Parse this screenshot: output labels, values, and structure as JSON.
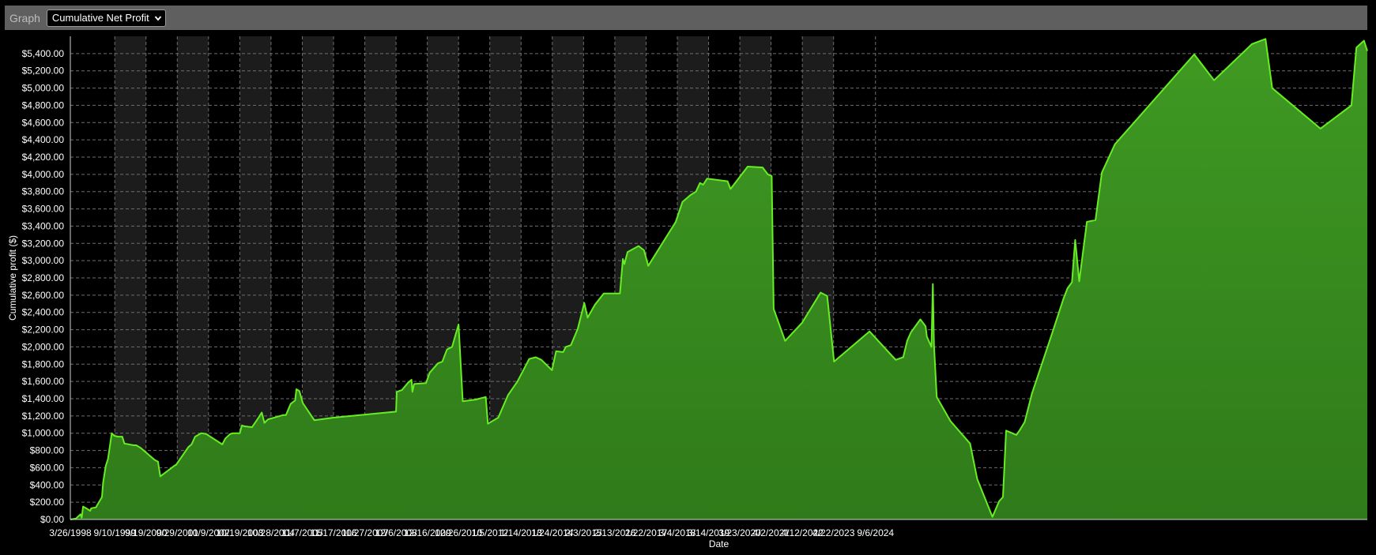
{
  "toolbar": {
    "label": "Graph",
    "selected_graph": "Cumulative Net Profit",
    "dropdown_icon": "chevron-down-icon"
  },
  "colors": {
    "background": "#000000",
    "band": "#1c1c1c",
    "grid": "#6e6e6e",
    "line": "#66ee22",
    "fill": "#3f9a22",
    "fill_bottom": "#2f7a1a",
    "text": "#ffffff"
  },
  "chart_data": {
    "type": "area",
    "xlabel": "Date",
    "ylabel": "Cumulative profit ($)",
    "ylim": [
      0,
      5600
    ],
    "yticks": [
      0,
      200,
      400,
      600,
      800,
      1000,
      1200,
      1400,
      1600,
      1800,
      2000,
      2200,
      2400,
      2600,
      2800,
      3000,
      3200,
      3400,
      3600,
      3800,
      4000,
      4200,
      4400,
      4600,
      4800,
      5000,
      5200,
      5400
    ],
    "ytick_labels": [
      "$0.00",
      "$200.00",
      "$400.00",
      "$600.00",
      "$800.00",
      "$1,000.00",
      "$1,200.00",
      "$1,400.00",
      "$1,600.00",
      "$1,800.00",
      "$2,000.00",
      "$2,200.00",
      "$2,400.00",
      "$2,600.00",
      "$2,800.00",
      "$3,000.00",
      "$3,200.00",
      "$3,400.00",
      "$3,600.00",
      "$3,800.00",
      "$4,000.00",
      "$4,200.00",
      "$4,400.00",
      "$4,600.00",
      "$4,800.00",
      "$5,000.00",
      "$5,200.00",
      "$5,400.00"
    ],
    "xticks": [
      "3/26/1998",
      "9/10/1999",
      "9/19/2000",
      "9/29/2001",
      "10/9/2002",
      "10/19/2003",
      "10/28/2004",
      "11/7/2005",
      "11/17/2006",
      "11/27/2007",
      "12/6/2008",
      "12/16/2009",
      "12/26/2010",
      "1/5/2012",
      "1/14/2013",
      "1/24/2014",
      "2/3/2015",
      "2/13/2016",
      "2/22/2017",
      "3/4/2018",
      "3/14/2019",
      "3/23/2020",
      "4/2/2021",
      "4/12/2022",
      "4/22/2023",
      "9/6/2024"
    ],
    "grid": true,
    "legend": "none",
    "series": [
      {
        "points": [
          [
            "3/26/1998",
            0
          ],
          [
            "6/1/1998",
            10
          ],
          [
            "7/26/1998",
            60
          ],
          [
            "8/10/1998",
            20
          ],
          [
            "8/26/1998",
            150
          ],
          [
            "10/20/1998",
            120
          ],
          [
            "11/19/1998",
            100
          ],
          [
            "12/1/1998",
            130
          ],
          [
            "1/26/1999",
            140
          ],
          [
            "4/9/1999",
            260
          ],
          [
            "4/24/1999",
            430
          ],
          [
            "5/25/1999",
            620
          ],
          [
            "6/20/1999",
            700
          ],
          [
            "8/5/1999",
            1000
          ],
          [
            "9/4/1999",
            970
          ],
          [
            "10/20/1999",
            960
          ],
          [
            "12/9/1999",
            960
          ],
          [
            "1/4/2000",
            880
          ],
          [
            "4/25/2000",
            860
          ],
          [
            "5/25/2000",
            860
          ],
          [
            "7/16/2000",
            830
          ],
          [
            "1/2/2001",
            690
          ],
          [
            "2/10/2001",
            670
          ],
          [
            "3/9/2001",
            500
          ],
          [
            "9/5/2001",
            630
          ],
          [
            "9/13/2001",
            630
          ],
          [
            "12/15/2001",
            760
          ],
          [
            "2/10/2002",
            840
          ],
          [
            "3/20/2002",
            870
          ],
          [
            "4/30/2002",
            960
          ],
          [
            "7/14/2002",
            1000
          ],
          [
            "9/13/2002",
            990
          ],
          [
            "3/23/2003",
            870
          ],
          [
            "4/30/2003",
            940
          ],
          [
            "6/25/2003",
            990
          ],
          [
            "7/31/2003",
            1000
          ],
          [
            "8/15/2003",
            1000
          ],
          [
            "10/19/2003",
            1000
          ],
          [
            "11/13/2003",
            1090
          ],
          [
            "12/19/2003",
            1080
          ],
          [
            "3/14/2004",
            1070
          ],
          [
            "6/7/2004",
            1190
          ],
          [
            "7/9/2004",
            1240
          ],
          [
            "8/10/2004",
            1120
          ],
          [
            "9/22/2004",
            1160
          ],
          [
            "3/20/2005",
            1210
          ],
          [
            "4/25/2005",
            1210
          ],
          [
            "6/20/2005",
            1340
          ],
          [
            "8/13/2005",
            1380
          ],
          [
            "8/28/2005",
            1510
          ],
          [
            "10/3/2005",
            1490
          ],
          [
            "11/13/2005",
            1350
          ],
          [
            "4/1/2006",
            1150
          ],
          [
            "11/17/2006",
            1180
          ],
          [
            "12/6/2008",
            1250
          ],
          [
            "12/15/2008",
            1480
          ],
          [
            "2/14/2009",
            1500
          ],
          [
            "4/24/2009",
            1580
          ],
          [
            "6/10/2009",
            1620
          ],
          [
            "6/20/2009",
            1480
          ],
          [
            "7/10/2009",
            1570
          ],
          [
            "11/30/2009",
            1580
          ],
          [
            "1/13/2010",
            1700
          ],
          [
            "4/23/2010",
            1810
          ],
          [
            "6/15/2010",
            1830
          ],
          [
            "8/9/2010",
            1970
          ],
          [
            "10/9/2010",
            2000
          ],
          [
            "12/26/2010",
            2260
          ],
          [
            "2/14/2011",
            1370
          ],
          [
            "7/20/2011",
            1390
          ],
          [
            "11/17/2011",
            1420
          ],
          [
            "12/13/2011",
            1110
          ],
          [
            "4/15/2012",
            1180
          ],
          [
            "8/10/2012",
            1440
          ],
          [
            "12/3/2012",
            1600
          ],
          [
            "4/21/2013",
            1860
          ],
          [
            "7/10/2013",
            1880
          ],
          [
            "9/15/2013",
            1850
          ],
          [
            "1/20/2014",
            1730
          ],
          [
            "3/10/2014",
            1950
          ],
          [
            "6/4/2014",
            1940
          ],
          [
            "7/4/2014",
            2000
          ],
          [
            "9/4/2014",
            2020
          ],
          [
            "11/25/2014",
            2210
          ],
          [
            "2/12/2015",
            2510
          ],
          [
            "3/24/2015",
            2340
          ],
          [
            "6/20/2015",
            2490
          ],
          [
            "10/3/2015",
            2620
          ],
          [
            "1/20/2016",
            2620
          ],
          [
            "4/15/2016",
            2620
          ],
          [
            "5/20/2016",
            3020
          ],
          [
            "6/7/2016",
            2960
          ],
          [
            "7/15/2016",
            3100
          ],
          [
            "11/24/2016",
            3170
          ],
          [
            "1/28/2017",
            3120
          ],
          [
            "3/20/2017",
            2940
          ],
          [
            "2/13/2018",
            3450
          ],
          [
            "5/5/2018",
            3680
          ],
          [
            "8/8/2018",
            3760
          ],
          [
            "10/14/2018",
            3800
          ],
          [
            "11/30/2018",
            3900
          ],
          [
            "1/8/2019",
            3880
          ],
          [
            "2/24/2019",
            3950
          ],
          [
            "10/28/2019",
            3920
          ],
          [
            "12/2/2019",
            3830
          ],
          [
            "6/25/2020",
            4090
          ],
          [
            "12/21/2020",
            4080
          ],
          [
            "2/22/2021",
            4000
          ],
          [
            "4/9/2021",
            3980
          ],
          [
            "5/3/2021",
            2440
          ],
          [
            "9/18/2021",
            2070
          ],
          [
            "4/10/2022",
            2280
          ],
          [
            "11/17/2022",
            2630
          ],
          [
            "2/4/2023",
            2590
          ],
          [
            "4/28/2023",
            1830
          ],
          [
            "6/26/2024",
            2180
          ],
          [
            "5/6/2025",
            1850
          ],
          [
            "8/4/2025",
            1880
          ],
          [
            "9/21/2025",
            2070
          ],
          [
            "11/5/2025",
            2170
          ],
          [
            "2/26/2026",
            2320
          ],
          [
            "4/30/2026",
            2240
          ],
          [
            "5/15/2026",
            2120
          ],
          [
            "7/9/2026",
            2000
          ],
          [
            "7/26/2026",
            2730
          ],
          [
            "8/8/2026",
            2030
          ],
          [
            "9/11/2026",
            1420
          ],
          [
            "2/23/2027",
            1140
          ],
          [
            "10/16/2027",
            880
          ],
          [
            "1/9/2028",
            470
          ],
          [
            "7/10/2028",
            30
          ],
          [
            "9/28/2028",
            210
          ],
          [
            "11/13/2028",
            260
          ],
          [
            "12/21/2028",
            1030
          ],
          [
            "4/23/2029",
            980
          ],
          [
            "6/6/2029",
            1040
          ],
          [
            "8/1/2029",
            1130
          ],
          [
            "10/27/2029",
            1460
          ],
          [
            "7/4/2030",
            2180
          ],
          [
            "11/10/2030",
            2560
          ],
          [
            "12/28/2030",
            2680
          ],
          [
            "2/19/2031",
            2750
          ],
          [
            "3/30/2031",
            3240
          ],
          [
            "5/17/2031",
            2760
          ],
          [
            "8/17/2031",
            3450
          ],
          [
            "11/29/2031",
            3470
          ],
          [
            "2/13/2032",
            4020
          ],
          [
            "7/19/2032",
            4350
          ],
          [
            "2/25/2035",
            5390
          ],
          [
            "10/21/2035",
            5090
          ],
          [
            "1/17/2037",
            5510
          ],
          [
            "6/30/2037",
            5570
          ],
          [
            "9/18/2037",
            5000
          ],
          [
            "4/20/2039",
            4530
          ],
          [
            "4/25/2040",
            4800
          ],
          [
            "6/24/2040",
            5470
          ],
          [
            "9/23/2040",
            5550
          ],
          [
            "11/2/2040",
            5430
          ]
        ]
      }
    ]
  }
}
